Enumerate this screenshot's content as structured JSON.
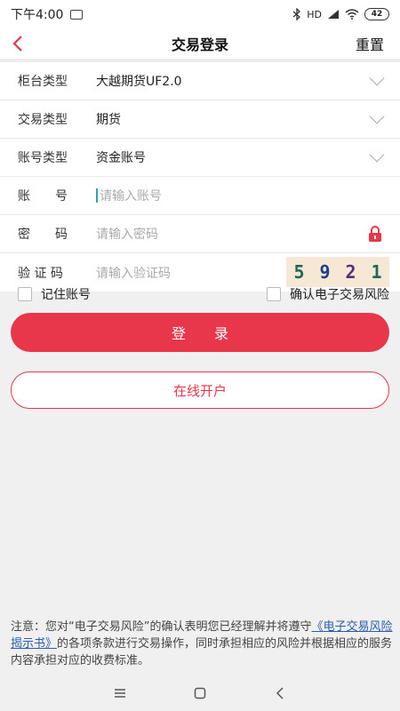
{
  "status": {
    "time": "下午4:00",
    "battery": "42",
    "network": "HD"
  },
  "nav": {
    "title": "交易登录",
    "reset": "重置"
  },
  "form": {
    "counter_type": {
      "label": "柜台类型",
      "value": "大越期货UF2.0"
    },
    "trade_type": {
      "label": "交易类型",
      "value": "期货"
    },
    "account_type": {
      "label": "账号类型",
      "value": "资金账号"
    },
    "account": {
      "label": "账　　号",
      "placeholder": "请输入账号"
    },
    "password": {
      "label": "密　　码",
      "placeholder": "请输入密码"
    },
    "captcha": {
      "label": "验 证 码",
      "placeholder": "请输入验证码",
      "code": [
        "5",
        "9",
        "2",
        "1"
      ]
    }
  },
  "options": {
    "remember": "记住账号",
    "confirm_risk": "确认电子交易风险"
  },
  "buttons": {
    "login": "登　　录",
    "open_account": "在线开户"
  },
  "notice": {
    "prefix": "注意：您对“电子交易风险”的确认表明您已经理解并将遵守",
    "link": "《电子交易风险揭示书》",
    "suffix": "的各项条款进行交易操作，同时承担相应的风险并根据相应的服务内容承担对应的收费标准。"
  },
  "colors": {
    "accent": "#e8374a",
    "link": "#2a5db0"
  }
}
